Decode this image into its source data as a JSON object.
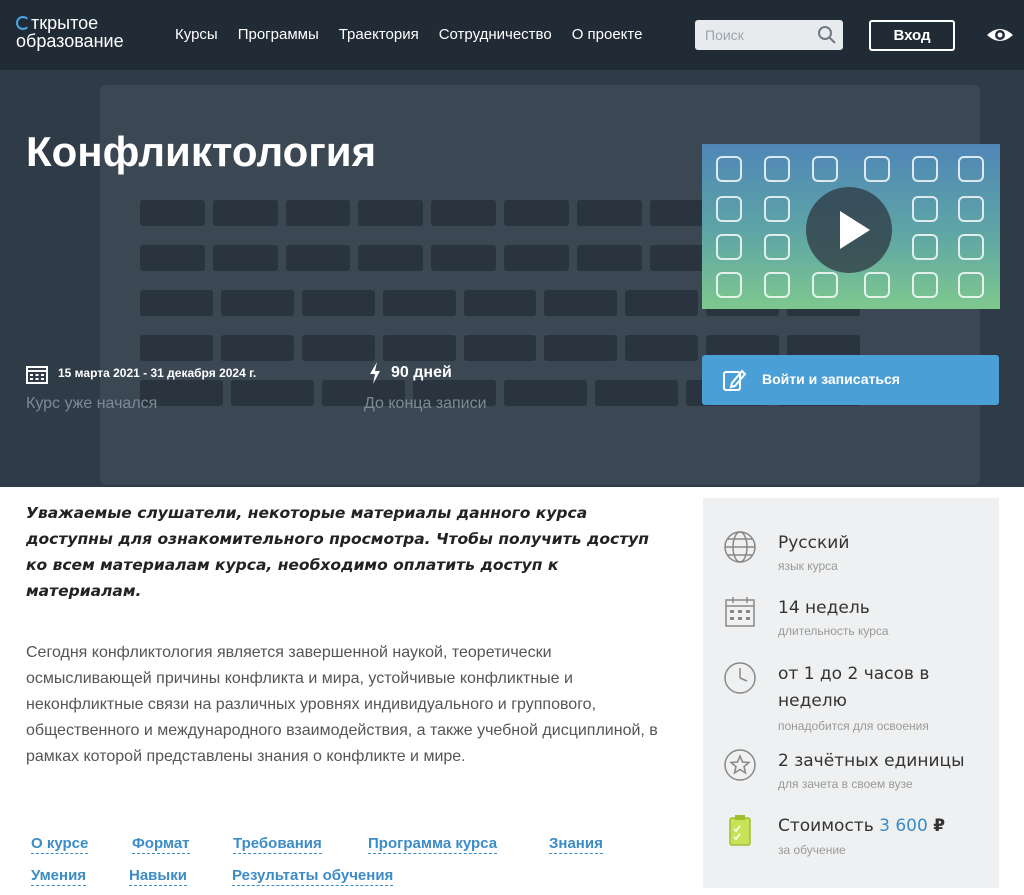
{
  "header": {
    "logo_line1": "ткрытое",
    "logo_line2": "образование",
    "nav": [
      "Курсы",
      "Программы",
      "Траектория",
      "Сотрудничество",
      "О проекте"
    ],
    "search_placeholder": "Поиск",
    "login_label": "Вход"
  },
  "hero": {
    "title": "Конфликтология",
    "dates": "15 марта 2021 - 31 декабря 2024 г.",
    "started": "Курс уже начался",
    "days": "90 дней",
    "until": "До конца записи",
    "enroll_label": "Войти и записаться"
  },
  "content": {
    "notice": "Уважаемые слушатели, некоторые материалы данного курса доступны для ознакомительного просмотра. Чтобы получить доступ ко всем материалам курса, необходимо оплатить доступ к материалам.",
    "description": "Сегодня конфликтология является завершенной наукой, теоретически осмысливающей причины конфликта и мира, устойчивые конфликтные и неконфликтные связи на различных уровнях индивидуального и группового, общественного и международного взаимодействия, а также учебной дисциплиной, в рамках которой представлены знания о конфликте и мире.",
    "tabs": [
      "О курсе",
      "Формат",
      "Требования",
      "Программа курса",
      "Знания",
      "Умения",
      "Навыки",
      "Результаты обучения"
    ]
  },
  "sidebar": {
    "language": {
      "value": "Русский",
      "label": "язык курса"
    },
    "duration": {
      "value": "14 недель",
      "label": "длительность курса"
    },
    "effort": {
      "value": "от 1 до 2 часов в неделю",
      "label": "понадобится для освоения"
    },
    "credits": {
      "value": "2 зачётных единицы",
      "label": "для зачета в своем вузе"
    },
    "cost": {
      "prefix": "Стоимость",
      "amount": "3 600",
      "currency": "₽",
      "label": "за обучение"
    }
  },
  "colors": {
    "header_bg": "#202b35",
    "accent": "#4a9fd6",
    "link": "#3c8cc7"
  }
}
